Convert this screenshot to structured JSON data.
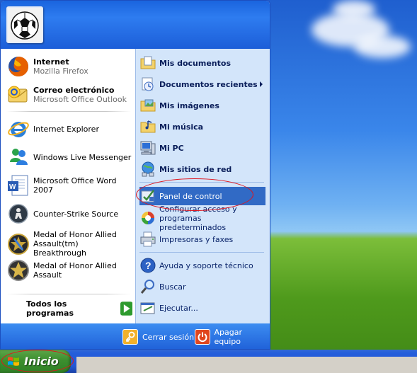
{
  "start_menu": {
    "pinned": [
      {
        "title": "Internet",
        "subtitle": "Mozilla Firefox"
      },
      {
        "title": "Correo electrónico",
        "subtitle": "Microsoft Office Outlook"
      }
    ],
    "recent": [
      {
        "title": "Internet Explorer"
      },
      {
        "title": "Windows Live Messenger"
      },
      {
        "title": "Microsoft Office Word 2007"
      },
      {
        "title": "Counter-Strike Source"
      },
      {
        "title": "Medal of Honor Allied Assault(tm) Breakthrough"
      },
      {
        "title": "Medal of Honor Allied Assault"
      }
    ],
    "all_programs": "Todos los programas",
    "places": [
      {
        "label": "Mis documentos"
      },
      {
        "label": "Documentos recientes"
      },
      {
        "label": "Mis imágenes"
      },
      {
        "label": "Mi música"
      },
      {
        "label": "Mi PC"
      },
      {
        "label": "Mis sitios de red"
      }
    ],
    "settings": [
      {
        "label": "Panel de control"
      },
      {
        "label": "Configurar acceso y programas predeterminados"
      },
      {
        "label": "Impresoras y faxes"
      }
    ],
    "help": [
      {
        "label": "Ayuda y soporte técnico"
      },
      {
        "label": "Buscar"
      },
      {
        "label": "Ejecutar..."
      }
    ],
    "footer": {
      "logoff": "Cerrar sesión",
      "shutdown": "Apagar equipo"
    }
  },
  "taskbar": {
    "start_label": "Inicio"
  },
  "colors": {
    "highlight": "#316ac5",
    "annotation": "#e0141c"
  }
}
